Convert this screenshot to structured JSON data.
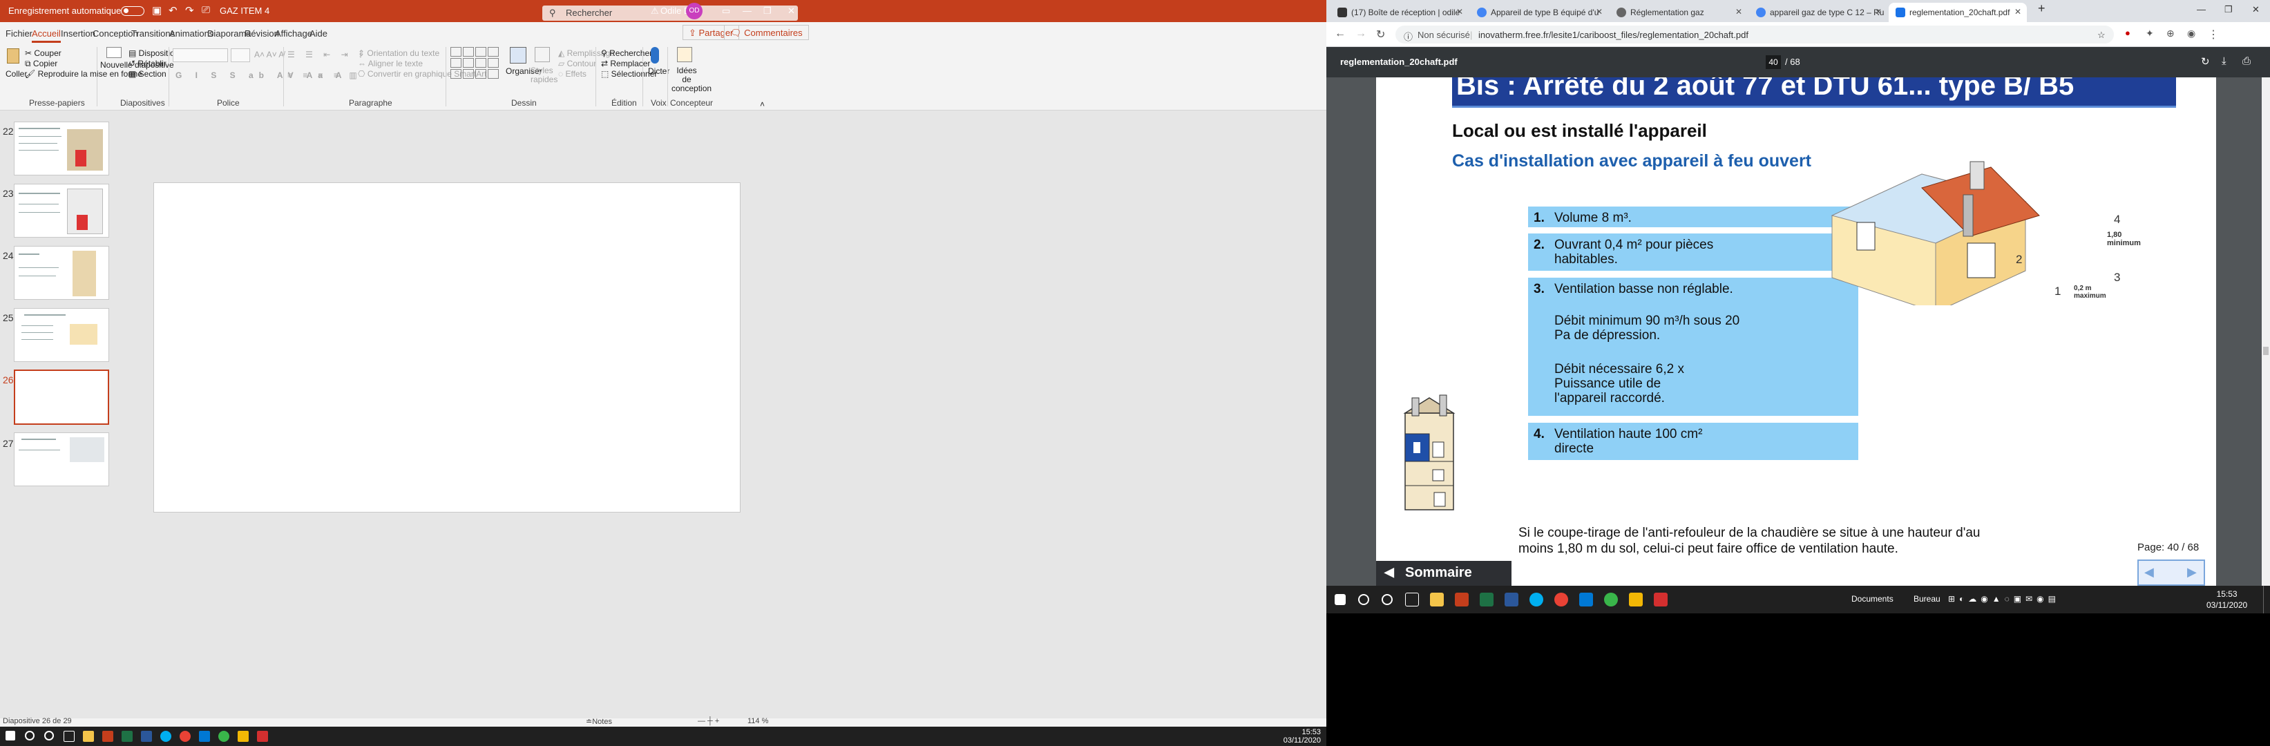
{
  "ppt": {
    "autosave": "Enregistrement automatique",
    "doc_title": "GAZ ITEM 4",
    "search": "Rechercher",
    "warning_icon": "warning-icon",
    "user_name": "Odile Diot",
    "user_initials": "OD",
    "tabs": [
      "Fichier",
      "Accueil",
      "Insertion",
      "Conception",
      "Transitions",
      "Animations",
      "Diaporama",
      "Révision",
      "Affichage",
      "Aide"
    ],
    "share": "Partager",
    "comments": "Commentaires",
    "ribbon": {
      "paste": "Coller",
      "cut": "Couper",
      "copy": "Copier",
      "format_painter": "Reproduire la mise en forme",
      "new_slide": "Nouvelle diapositive",
      "layout": "Disposition",
      "reset": "Rétablir",
      "section": "Section",
      "text_direction": "Orientation du texte",
      "align_text": "Aligner le texte",
      "smartart": "Convertir en graphique SmartArt",
      "arrange": "Organiser",
      "quick_styles": "Styles rapides",
      "fill": "Remplissage",
      "outline": "Contour",
      "effects": "Effets",
      "find": "Rechercher",
      "replace": "Remplacer",
      "select": "Sélectionner",
      "dictate": "Dicter",
      "design_ideas": "Idées de conception",
      "groups": [
        "Presse-papiers",
        "Diapositives",
        "Police",
        "Paragraphe",
        "Dessin",
        "Édition",
        "Voix",
        "Concepteur"
      ]
    },
    "slides": [
      {
        "num": "22",
        "title": "Caractéristiques des appareils de type B équipés"
      },
      {
        "num": "23",
        "title": "Caractéristiques des appareils de type C"
      },
      {
        "num": "24",
        "title": "Ventouse à ventouse"
      },
      {
        "num": "25",
        "title": "Local ou est installé l'appareil"
      },
      {
        "num": "26",
        "title": ""
      },
      {
        "num": "27",
        "title": "Appareils à circuit étanche"
      }
    ],
    "status": {
      "slide_info": "Diapositive 26 de 29",
      "notes": "Notes",
      "zoom": "114 %"
    },
    "taskbar_clock": {
      "time": "15:53",
      "date": "03/11/2020"
    }
  },
  "chrome": {
    "tabs": [
      {
        "label": "(17) Boîte de réception | odile",
        "color": "#333333"
      },
      {
        "label": "Appareil de type B équipé d'u",
        "color": "#4285f4"
      },
      {
        "label": "Réglementation gaz",
        "color": "#555555"
      },
      {
        "label": "appareil gaz de type C 12 – Ru",
        "color": "#4285f4"
      },
      {
        "label": "reglementation_20chaft.pdf",
        "color": "#1a73e8"
      }
    ],
    "insecure": "Non sécurisé",
    "url": "inovatherm.free.fr/lesite1/cariboost_files/reglementation_20chaft.pdf",
    "pdf": {
      "filename": "reglementation_20chaft.pdf",
      "page": "40",
      "total": "/ 68",
      "banner": "Bis : Arrêté du 2 août 77 et DTU 61... type B/ B5",
      "title": "Local ou est installé l'appareil",
      "subtitle": "Cas d'installation avec appareil à feu ouvert",
      "items": [
        {
          "n": "1.",
          "text": "Volume 8 m³."
        },
        {
          "n": "2.",
          "text": "Ouvrant 0,4 m² pour pièces habitables."
        },
        {
          "n": "3.",
          "text": "Ventilation basse non réglable.",
          "extra1": "Débit minimum 90 m³/h sous 20 Pa de dépression.",
          "extra2": "Débit nécessaire 6,2 x Puissance utile de l'appareil raccordé."
        },
        {
          "n": "4.",
          "text": "Ventilation haute 100 cm² directe"
        }
      ],
      "caption": "Si le coupe-tirage de l'anti-refouleur de la chaudière se situe à une hauteur d'au moins 1,80 m du sol, celui-ci peut faire office de ventilation haute.",
      "sommaire": "Sommaire",
      "page_ctl": "Page:  40 / 68",
      "diagram_labels": {
        "l1": "1",
        "l2": "2",
        "l3": "3",
        "l4": "4",
        "h1": "1,80 minimum",
        "h2": "0,2 m maximum"
      }
    },
    "taskbar": {
      "documents": "Documents",
      "bureau": "Bureau",
      "time": "15:53",
      "date": "03/11/2020"
    }
  }
}
